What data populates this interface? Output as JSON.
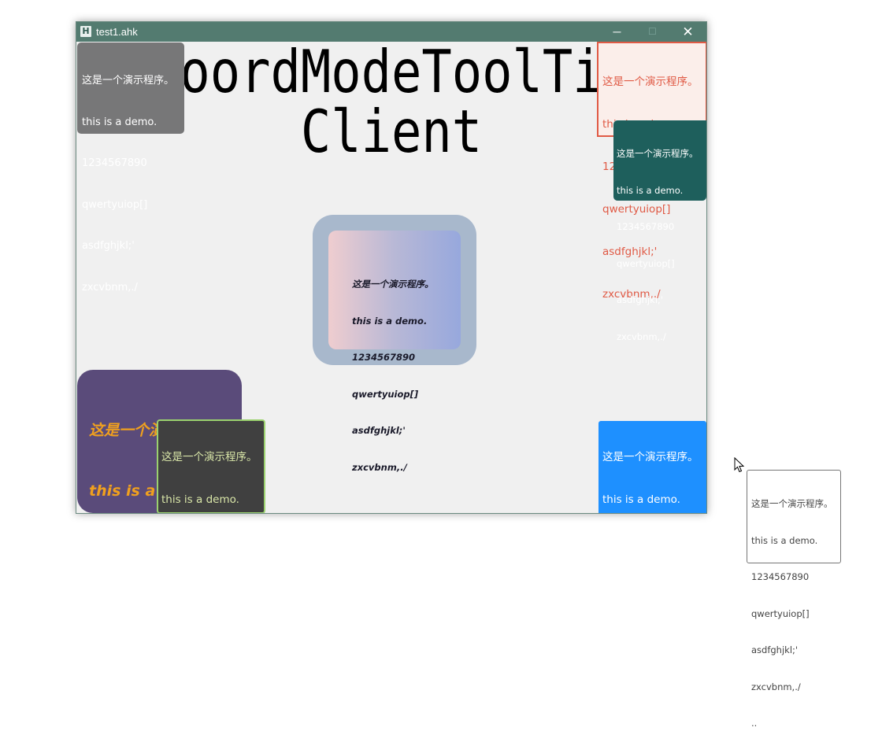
{
  "window": {
    "title": "test1.ahk",
    "icon_letter": "H",
    "buttons": {
      "minimize": "─",
      "maximize": "☐",
      "close": "✕"
    }
  },
  "big_text": {
    "line1": "CoordModeToolTip",
    "line2": "Client"
  },
  "tooltip_lines": [
    "这是一个演示程序。",
    "this is a demo.",
    "1234567890",
    "qwertyuiop[]",
    "asdfghjkl;'",
    "zxcvbnm,./"
  ],
  "tooltip_extra_line": "..",
  "colors": {
    "titlebar": "#537b70",
    "gray_tip": "#777778",
    "red_tip_border": "#e05a45",
    "teal_tip": "#1e5f5c",
    "purple_tip": "#5a4b7a",
    "purple_tip_text": "#f0a01e",
    "dark_tip_border": "#9bd16e",
    "blue_tip": "#1e90ff"
  },
  "icons": {
    "app": "ahk-app-icon",
    "cursor": "mouse-pointer-icon"
  }
}
